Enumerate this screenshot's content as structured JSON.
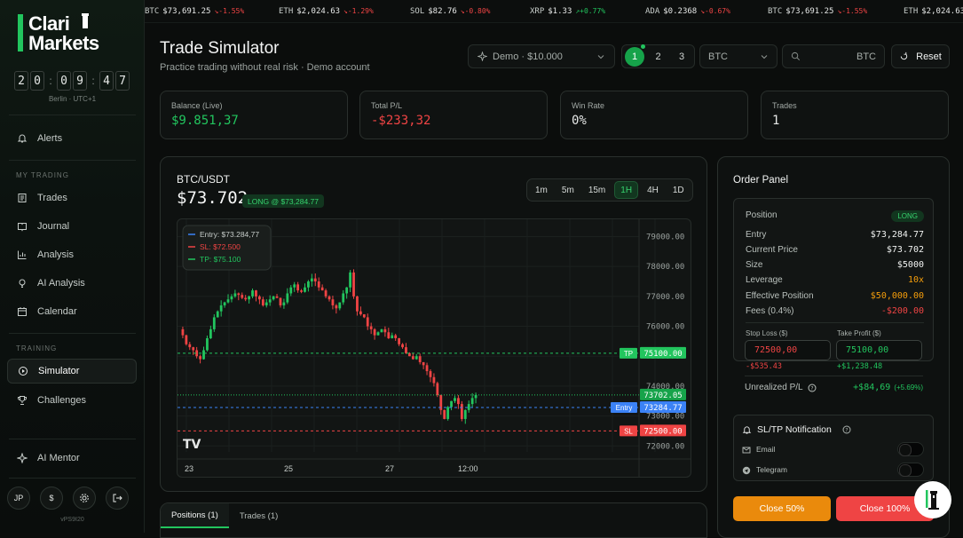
{
  "app": {
    "logo_line1": "Clari",
    "logo_line2": "Markets",
    "clock_digits": [
      "2",
      "0",
      "0",
      "9",
      "4",
      "7"
    ],
    "timezone": "Berlin · UTC+1",
    "version": "vPS9I20"
  },
  "ticker": [
    {
      "sym": "BTC",
      "val": "$73,691.25",
      "chg": "↘-1.55%",
      "dir": "neg"
    },
    {
      "sym": "ETH",
      "val": "$2,024.63",
      "chg": "↘-1.29%",
      "dir": "neg"
    },
    {
      "sym": "SOL",
      "val": "$82.76",
      "chg": "↘-0.80%",
      "dir": "neg"
    },
    {
      "sym": "XRP",
      "val": "$1.33",
      "chg": "↗+0.77%",
      "dir": "pos"
    },
    {
      "sym": "ADA",
      "val": "$0.2368",
      "chg": "↘-0.67%",
      "dir": "neg"
    },
    {
      "sym": "BTC",
      "val": "$73,691.25",
      "chg": "↘-1.55%",
      "dir": "neg"
    },
    {
      "sym": "ETH",
      "val": "$2,024.63",
      "chg": "",
      "dir": "neg"
    }
  ],
  "sidebar": {
    "alerts": "Alerts",
    "section_trading": "MY TRADING",
    "trades": "Trades",
    "journal": "Journal",
    "analysis": "Analysis",
    "ai_analysis": "AI Analysis",
    "calendar": "Calendar",
    "section_training": "TRAINING",
    "simulator": "Simulator",
    "challenges": "Challenges",
    "ai_mentor": "AI Mentor",
    "user_initials": "JP",
    "currency_symbol": "$"
  },
  "header": {
    "title": "Trade Simulator",
    "subtitle": "Practice trading without real risk · Demo account",
    "account": "Demo · $10.000",
    "layouts": [
      "1",
      "2",
      "3"
    ],
    "symbol": "BTC",
    "search_value": "BTC",
    "reset": "Reset"
  },
  "stats": [
    {
      "label": "Balance (Live)",
      "value": "$9.851,37",
      "color": "#22c55e"
    },
    {
      "label": "Total P/L",
      "value": "-$233,32",
      "color": "#ef4444"
    },
    {
      "label": "Win Rate",
      "value": "0%",
      "color": "#f1f3f2"
    },
    {
      "label": "Trades",
      "value": "1",
      "color": "#f1f3f2"
    }
  ],
  "chart_panel": {
    "pair": "BTC/USDT",
    "price": "$73.702",
    "position_badge": "LONG @ $73,284.77",
    "timeframes": [
      "1m",
      "5m",
      "15m",
      "1H",
      "4H",
      "1D"
    ],
    "active_timeframe": "1H"
  },
  "chart_data": {
    "type": "candlestick",
    "ylim": [
      71800,
      79400
    ],
    "y_ticks": [
      "79000.00",
      "78000.00",
      "77000.00",
      "76000.00",
      "75000.00",
      "74000.00",
      "73000.00",
      "72000.00"
    ],
    "x_ticks": [
      "23",
      "25",
      "27",
      "12:00"
    ],
    "legend": [
      "Entry: $73.284,77",
      "SL: $72.500",
      "TP: $75.100"
    ],
    "lines": [
      {
        "name": "TP",
        "value": 75100,
        "label": "75100.00",
        "color": "#22c55e"
      },
      {
        "name": "Entry",
        "value": 73284.77,
        "label": "73284.77",
        "color": "#3b82f6"
      },
      {
        "name": "SL",
        "value": 72500,
        "label": "72500.00",
        "color": "#ef4444"
      }
    ],
    "current_price": {
      "value": 73702.05,
      "label": "73702.05"
    },
    "path": [
      75900,
      75700,
      75400,
      75300,
      75200,
      75000,
      74900,
      75200,
      75600,
      75900,
      76300,
      76500,
      76700,
      76800,
      76900,
      77000,
      77100,
      77050,
      76950,
      76900,
      77000,
      77200,
      77000,
      76900,
      76700,
      76800,
      76900,
      77000,
      76950,
      76700,
      76800,
      77100,
      77300,
      77400,
      77200,
      77150,
      77300,
      77500,
      77600,
      77500,
      77300,
      77200,
      77000,
      76900,
      76700,
      76600,
      76800,
      77100,
      77300,
      77800,
      77000,
      76500,
      76400,
      76300,
      76000,
      75900,
      75700,
      75800,
      75900,
      75800,
      75600,
      75700,
      75600,
      75400,
      75300,
      75100,
      75000,
      74900,
      75000,
      74800,
      74700,
      74500,
      74300,
      74100,
      73700,
      73200,
      72900,
      73300,
      73500,
      73600,
      73400,
      72900,
      73200,
      73400,
      73600,
      73702
    ]
  },
  "tabs": [
    "Positions (1)",
    "Trades (1)"
  ],
  "order_panel": {
    "title": "Order Panel",
    "position_label": "Position",
    "position_side": "LONG",
    "rows": [
      {
        "label": "Entry",
        "value": "$73,284.77",
        "color": "#f1f3f2"
      },
      {
        "label": "Current Price",
        "value": "$73.702",
        "color": "#f1f3f2"
      },
      {
        "label": "Size",
        "value": "$5000",
        "color": "#f1f3f2"
      },
      {
        "label": "Leverage",
        "value": "10x",
        "color": "#f59e0b"
      },
      {
        "label": "Effective Position",
        "value": "$50,000.00",
        "color": "#f59e0b"
      },
      {
        "label": "Fees (0.4%)",
        "value": "-$200.00",
        "color": "#ef4444"
      }
    ],
    "sl_label": "Stop Loss ($)",
    "sl_value": "72500,00",
    "sl_sub": "-$535.43",
    "tp_label": "Take Profit ($)",
    "tp_value": "75100,00",
    "tp_sub": "+$1,238.48",
    "upnl_label": "Unrealized P/L",
    "upnl_value": "+$84,69",
    "upnl_pct": "(+5.69%)",
    "notif_title": "SL/TP Notification",
    "email": "Email",
    "telegram": "Telegram",
    "close_half": "Close 50%",
    "close_all": "Close 100%"
  }
}
